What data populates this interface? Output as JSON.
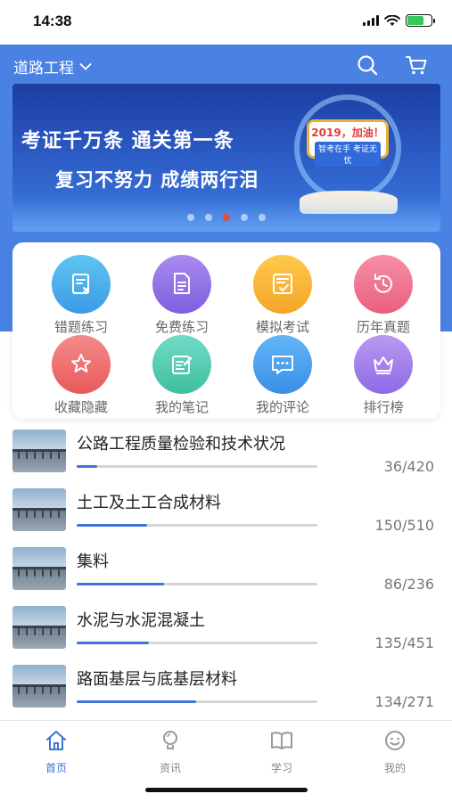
{
  "status_bar": {
    "time": "14:38"
  },
  "header": {
    "region": "道路工程"
  },
  "banner": {
    "line1": "考证千万条 通关第一条",
    "line2": "复习不努力 成绩两行泪",
    "badge_title": "2019，加油！",
    "badge_sub": "智考在手 考证无忧",
    "dot_count": 5,
    "active_dot": 2
  },
  "grid": [
    {
      "label": "错题练习",
      "icon": "wrong-questions-icon",
      "colors": [
        "#5ec4f0",
        "#3c9be6"
      ]
    },
    {
      "label": "免费练习",
      "icon": "free-practice-icon",
      "colors": [
        "#a98bef",
        "#7d5ee0"
      ]
    },
    {
      "label": "模拟考试",
      "icon": "mock-exam-icon",
      "colors": [
        "#ffc94a",
        "#f4a52a"
      ]
    },
    {
      "label": "历年真题",
      "icon": "past-papers-icon",
      "colors": [
        "#f78fa6",
        "#ea5f7d"
      ]
    },
    {
      "label": "收藏隐藏",
      "icon": "favorite-icon",
      "colors": [
        "#f58a8a",
        "#e85a5a"
      ]
    },
    {
      "label": "我的笔记",
      "icon": "notes-icon",
      "colors": [
        "#6fdcc6",
        "#3fbf9f"
      ]
    },
    {
      "label": "我的评论",
      "icon": "comments-icon",
      "colors": [
        "#63b6f7",
        "#3a8fe6"
      ]
    },
    {
      "label": "排行榜",
      "icon": "ranking-icon",
      "colors": [
        "#b89af2",
        "#8f6ae3"
      ]
    }
  ],
  "chapters": [
    {
      "title": "公路工程质量检验和技术状况",
      "done": 36,
      "total": 420,
      "count": "36/420"
    },
    {
      "title": "土工及土工合成材料",
      "done": 150,
      "total": 510,
      "count": "150/510"
    },
    {
      "title": "集料",
      "done": 86,
      "total": 236,
      "count": "86/236"
    },
    {
      "title": "水泥与水泥混凝土",
      "done": 135,
      "total": 451,
      "count": "135/451"
    },
    {
      "title": "路面基层与底基层材料",
      "done": 134,
      "total": 271,
      "count": "134/271"
    }
  ],
  "tabs": [
    {
      "label": "首页",
      "icon": "home-icon",
      "active": true
    },
    {
      "label": "资讯",
      "icon": "news-icon",
      "active": false
    },
    {
      "label": "学习",
      "icon": "book-icon",
      "active": false
    },
    {
      "label": "我的",
      "icon": "profile-icon",
      "active": false
    }
  ],
  "colors": {
    "primary": "#4a82e3",
    "progress": "#3f73d6"
  }
}
